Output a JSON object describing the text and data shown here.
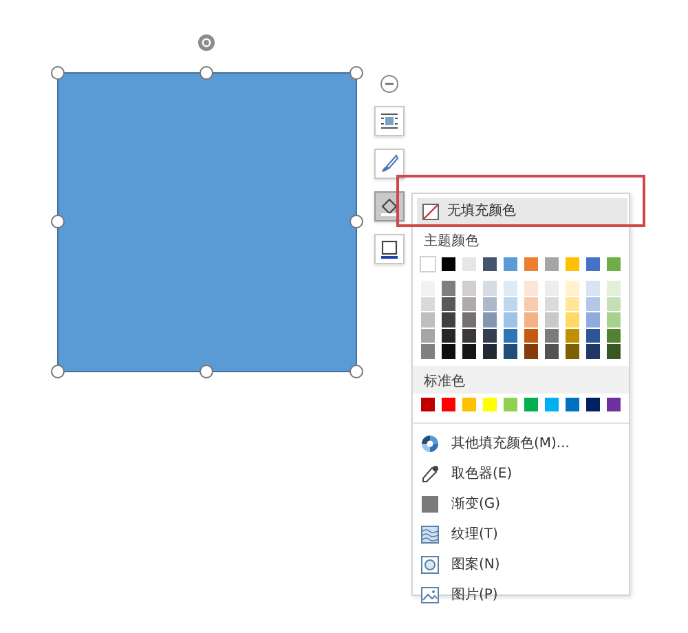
{
  "toolbar": [
    {
      "kind": "collapse"
    },
    {
      "kind": "layout",
      "selected": false
    },
    {
      "kind": "outline-style",
      "selected": false
    },
    {
      "kind": "fill",
      "selected": true
    },
    {
      "kind": "border",
      "selected": false
    }
  ],
  "fill_menu": {
    "no_fill": {
      "label": "无填充颜色",
      "hovered": true,
      "annotated": true
    },
    "theme_colors": {
      "label": "主题颜色",
      "swatches": [
        {
          "color": "#ffffff"
        },
        {
          "color": "#000000"
        },
        {
          "color": "#e7e6e6"
        },
        {
          "color": "#44546a"
        },
        {
          "color": "#5b9bd5"
        },
        {
          "color": "#ed7d31"
        },
        {
          "color": "#a5a5a5"
        },
        {
          "color": "#ffc000"
        },
        {
          "color": "#4472c4"
        },
        {
          "color": "#70ad47"
        }
      ],
      "shades": [
        [
          {
            "color": "#f2f2f2"
          },
          {
            "color": "#7f7f7f"
          },
          {
            "color": "#d0cece"
          },
          {
            "color": "#d6dce4"
          },
          {
            "color": "#deebf7"
          },
          {
            "color": "#fbe5d6"
          },
          {
            "color": "#ededed"
          },
          {
            "color": "#fff2cc"
          },
          {
            "color": "#dae3f3"
          },
          {
            "color": "#e2f0d9"
          }
        ],
        [
          {
            "color": "#d9d9d9"
          },
          {
            "color": "#595959"
          },
          {
            "color": "#aeaaaa"
          },
          {
            "color": "#adb9ca"
          },
          {
            "color": "#bdd7ee"
          },
          {
            "color": "#f8cbad"
          },
          {
            "color": "#dbdbdb"
          },
          {
            "color": "#ffe699"
          },
          {
            "color": "#b4c7e7"
          },
          {
            "color": "#c5e0b4"
          }
        ],
        [
          {
            "color": "#bfbfbf"
          },
          {
            "color": "#404040"
          },
          {
            "color": "#767171"
          },
          {
            "color": "#8497b0"
          },
          {
            "color": "#9dc3e6"
          },
          {
            "color": "#f4b183"
          },
          {
            "color": "#c9c9c9"
          },
          {
            "color": "#ffd966"
          },
          {
            "color": "#8faadc"
          },
          {
            "color": "#a9d18e"
          }
        ],
        [
          {
            "color": "#a6a6a6"
          },
          {
            "color": "#262626"
          },
          {
            "color": "#3b3838"
          },
          {
            "color": "#333f4f"
          },
          {
            "color": "#2e75b6"
          },
          {
            "color": "#c55a11"
          },
          {
            "color": "#7b7b7b"
          },
          {
            "color": "#bf9000"
          },
          {
            "color": "#2f5597"
          },
          {
            "color": "#548235"
          }
        ],
        [
          {
            "color": "#808080"
          },
          {
            "color": "#0d0d0d"
          },
          {
            "color": "#171616"
          },
          {
            "color": "#222a35"
          },
          {
            "color": "#1f4e79"
          },
          {
            "color": "#843c0c"
          },
          {
            "color": "#525252"
          },
          {
            "color": "#7f6000"
          },
          {
            "color": "#203864"
          },
          {
            "color": "#385723"
          }
        ]
      ]
    },
    "standard_colors": {
      "label": "标准色",
      "swatches": [
        {
          "color": "#c00000"
        },
        {
          "color": "#ff0000"
        },
        {
          "color": "#ffc000"
        },
        {
          "color": "#ffff00"
        },
        {
          "color": "#92d050"
        },
        {
          "color": "#00b050"
        },
        {
          "color": "#00b0f0"
        },
        {
          "color": "#0070c0"
        },
        {
          "color": "#002060"
        },
        {
          "color": "#7030a0"
        }
      ]
    },
    "items": [
      {
        "kind": "more-colors",
        "label": "其他填充颜色(M)..."
      },
      {
        "kind": "eyedropper",
        "label": "取色器(E)"
      },
      {
        "kind": "gradient",
        "label": "渐变(G)"
      },
      {
        "kind": "texture",
        "label": "纹理(T)"
      },
      {
        "kind": "pattern",
        "label": "图案(N)"
      },
      {
        "kind": "picture",
        "label": "图片(P)"
      }
    ]
  }
}
